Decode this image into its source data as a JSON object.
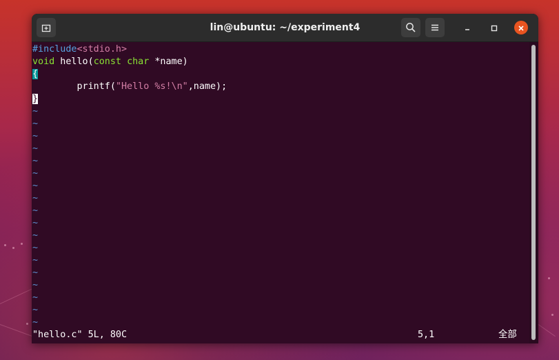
{
  "window": {
    "title": "lin@ubuntu: ~/experiment4"
  },
  "titlebar": {
    "new_tab_icon": "new-tab-icon",
    "search_icon": "search-icon",
    "menu_icon": "hamburger-menu-icon",
    "minimize_icon": "minimize-icon",
    "maximize_icon": "maximize-icon",
    "close_icon": "close-icon",
    "close_color": "#e95420"
  },
  "editor": {
    "line1": {
      "directive": "#include",
      "header": "<stdio.h>"
    },
    "line2": {
      "kw_void": "void",
      "fn": " hello(",
      "kw_const": "const",
      "sp": " ",
      "kw_char": "char",
      "rest": " *name)"
    },
    "line3": {
      "brace": "{"
    },
    "line4": {
      "indent": "        printf(",
      "str": "\"Hello %s!\\n\"",
      "rest": ",name);"
    },
    "line5": {
      "brace": "}"
    },
    "tilde": "~"
  },
  "statusline": {
    "file": "\"hello.c\" 5L, 80C",
    "position": "5,1",
    "percent": "全部"
  },
  "colors": {
    "terminal_bg": "#300a24",
    "include": "#57a3e0",
    "string": "#d47fa6",
    "type": "#8ae234",
    "tilde": "#5d8fd0",
    "match_brace": "#06989a"
  }
}
